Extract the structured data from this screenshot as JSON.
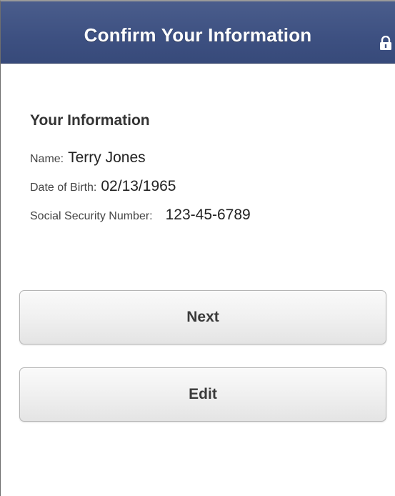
{
  "header": {
    "title": "Confirm Your Information",
    "lock_icon": "lock-icon"
  },
  "info": {
    "section_title": "Your Information",
    "name": {
      "label": "Name:",
      "value": "Terry Jones"
    },
    "dob": {
      "label": "Date of Birth:",
      "value": "02/13/1965"
    },
    "ssn": {
      "label": "Social Security Number:",
      "value": "123-45-6789"
    }
  },
  "buttons": {
    "next_label": "Next",
    "edit_label": "Edit"
  },
  "colors": {
    "header_bg": "#3d5081",
    "header_text": "#ffffff",
    "button_text": "#3a3a3a"
  }
}
